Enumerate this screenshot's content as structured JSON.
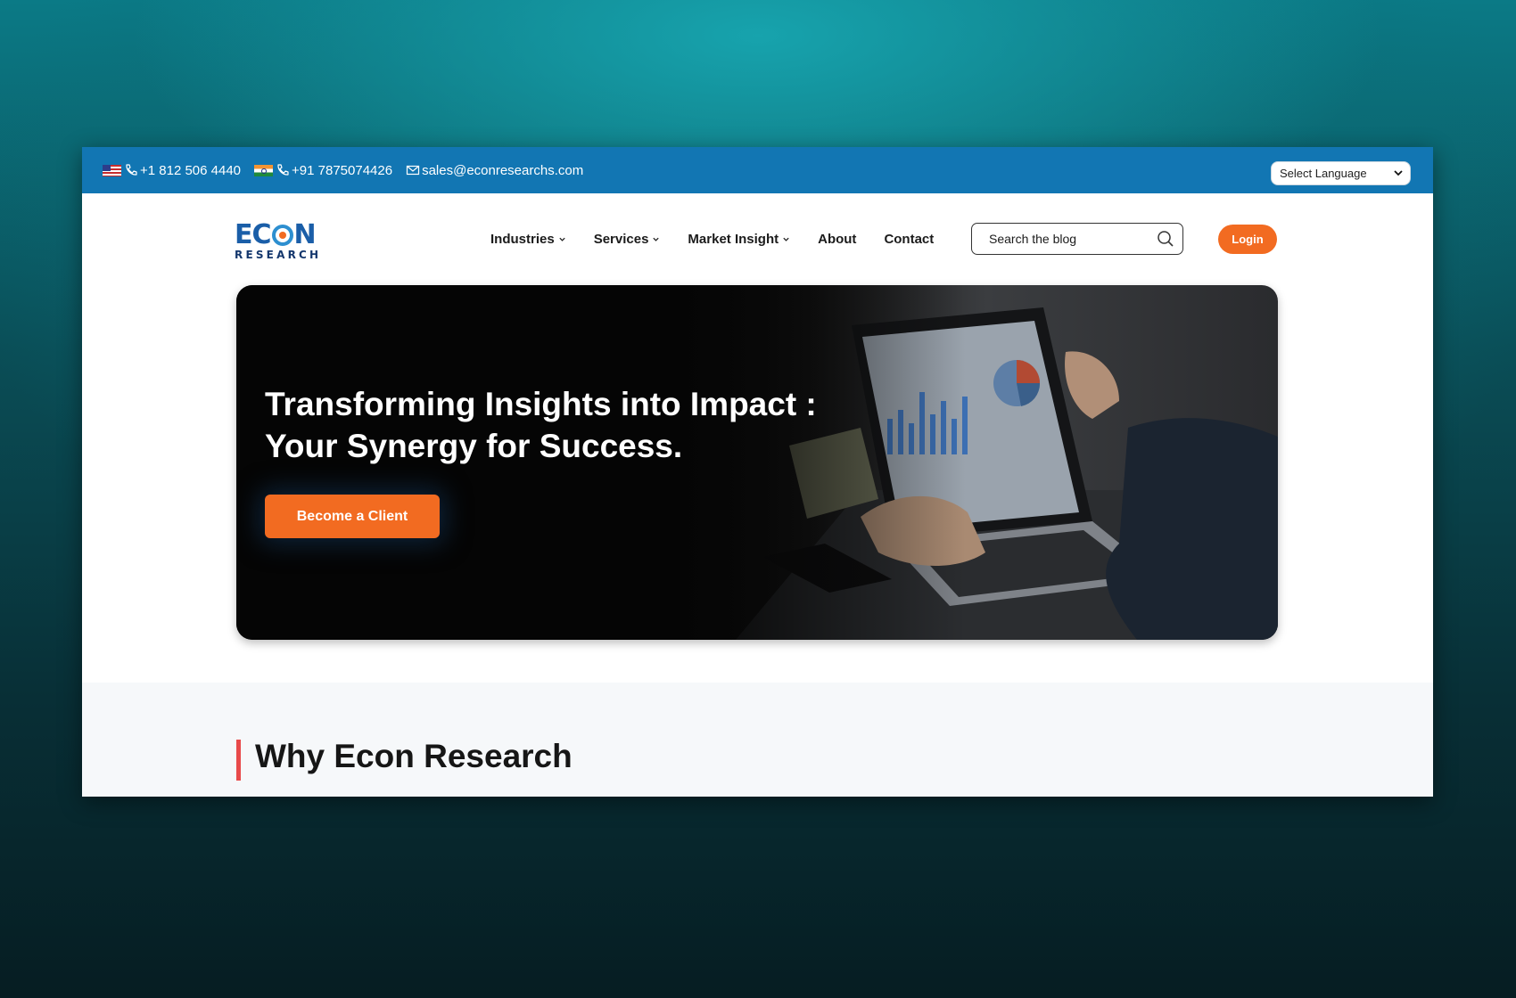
{
  "topbar": {
    "us_phone": "+1 812 506 4440",
    "in_phone": "+91 7875074426",
    "email": "sales@econresearchs.com",
    "language_select": "Select Language"
  },
  "logo": {
    "line1_left": "EC",
    "line1_right": "N",
    "line2": "RESEARCH"
  },
  "nav": {
    "items": [
      {
        "label": "Industries",
        "has_dropdown": true
      },
      {
        "label": "Services",
        "has_dropdown": true
      },
      {
        "label": "Market Insight",
        "has_dropdown": true
      },
      {
        "label": "About",
        "has_dropdown": false
      },
      {
        "label": "Contact",
        "has_dropdown": false
      }
    ],
    "search_placeholder": "Search the blog",
    "login_label": "Login"
  },
  "hero": {
    "title_line1": "Transforming Insights into Impact :",
    "title_line2": "Your Synergy for Success.",
    "cta_label": "Become a Client"
  },
  "why": {
    "title": "Why Econ Research"
  },
  "colors": {
    "topbar": "#1276b3",
    "accent": "#f26b21",
    "section_bar": "#e84a4a"
  }
}
